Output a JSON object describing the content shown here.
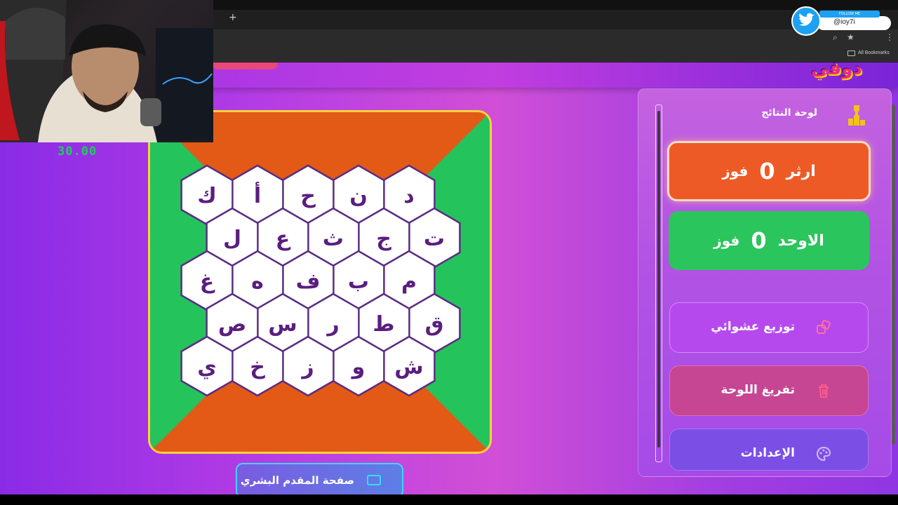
{
  "browser": {
    "new_tab": "+",
    "bookmarks_label": "All Bookmarks",
    "zoom_icon": "zoom-icon",
    "star_icon": "star-icon",
    "menu_icon": "menu-icon"
  },
  "overlay": {
    "timer": "30.00",
    "follow_text": "FOLLOW ME",
    "twitter_handle": "@ioy7i"
  },
  "board": {
    "colors": {
      "orange": "#e35a16",
      "green": "#24c35c",
      "border": "#ffd23a",
      "hex_fill": "#ffffff",
      "hex_stroke": "#5a2d83"
    },
    "rows": [
      [
        "د",
        "ن",
        "ح",
        "أ",
        "ك"
      ],
      [
        "ت",
        "ج",
        "ث",
        "ع",
        "ل"
      ],
      [
        "م",
        "ب",
        "ف",
        "ه",
        "غ"
      ],
      [
        "ق",
        "ط",
        "ر",
        "س",
        "ص"
      ],
      [
        "ش",
        "و",
        "ز",
        "خ",
        "ي"
      ]
    ]
  },
  "presenter_button": {
    "label": "صفحة المقدم البشري",
    "icon": "monitor-play-icon"
  },
  "scoreboard": {
    "title": "لوحة النتائج",
    "icon": "trophy-podium-icon",
    "team1": {
      "name": "ارثر",
      "score": "0",
      "unit": "فوز",
      "color": "#ee5a25"
    },
    "team2": {
      "name": "الاوحد",
      "score": "0",
      "unit": "فوز",
      "color": "#2ac55c"
    }
  },
  "actions": {
    "random": {
      "label": "توزيع عشوائي",
      "icon": "shuffle-cube-icon"
    },
    "clear": {
      "label": "تفريغ اللوحة",
      "icon": "trash-icon"
    },
    "settings": {
      "label": "الإعدادات",
      "icon": "palette-icon"
    }
  }
}
